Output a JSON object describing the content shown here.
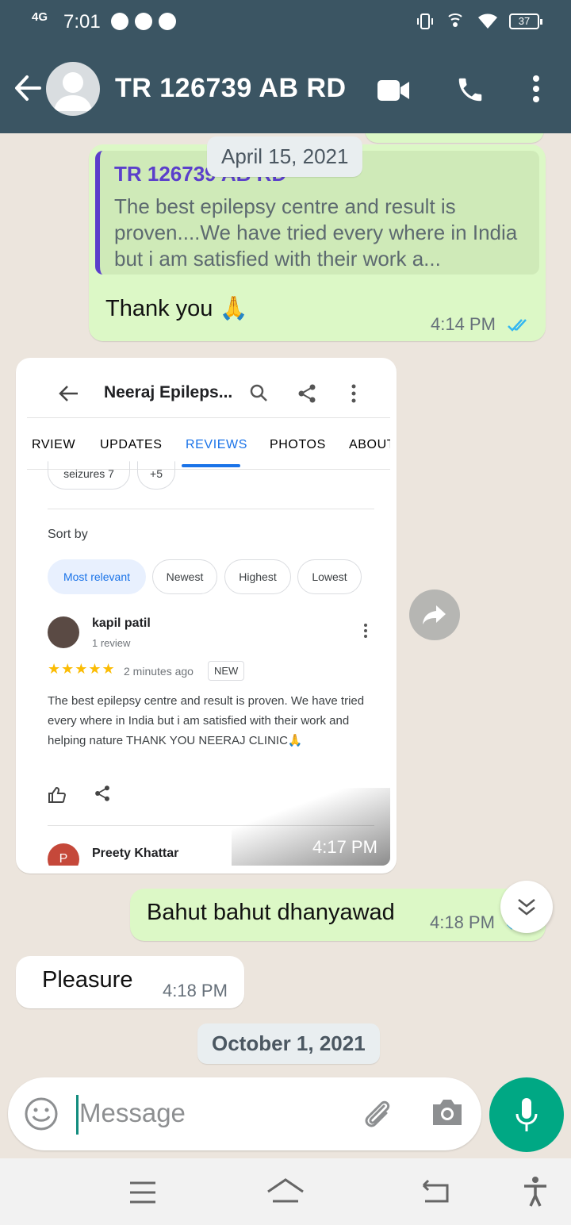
{
  "status_bar": {
    "network": "4G",
    "time": "7:01",
    "battery": "37"
  },
  "header": {
    "contact_name": "TR 126739 AB RD"
  },
  "chat": {
    "date_top": "April 15, 2021",
    "reply_message": {
      "quoted_author": "TR 126739 AB RD",
      "quoted_text": "The best epilepsy centre and result is proven....We have tried every where in India but i am satisfied with their work a...",
      "text": "Thank you 🙏",
      "time": "4:14 PM"
    },
    "image_message": {
      "time": "4:17 PM",
      "screenshot": {
        "title": "Neeraj Epileps...",
        "tabs": [
          "RVIEW",
          "UPDATES",
          "REVIEWS",
          "PHOTOS",
          "ABOUT"
        ],
        "topic_chips": [
          "seizures 7",
          "+5"
        ],
        "sort_label": "Sort by",
        "sort_chips": [
          "Most relevant",
          "Newest",
          "Highest",
          "Lowest"
        ],
        "reviewer": "kapil patil",
        "reviewer_meta": "1 review",
        "stars": "★★★★★",
        "review_time": "2 minutes ago",
        "new_badge": "NEW",
        "review_text": "The best epilepsy centre and result is proven. We have tried every where in India but i am satisfied with their work and helping nature  THANK YOU NEERAJ CLINIC🙏",
        "next_reviewer": "Preety Khattar",
        "next_initial": "P"
      }
    },
    "outgoing_2": {
      "text": "Bahut bahut dhanyawad",
      "time": "4:18 PM"
    },
    "incoming_1": {
      "text": "Pleasure",
      "time": "4:18 PM"
    },
    "date_bottom": "October 1, 2021"
  },
  "input": {
    "placeholder": "Message"
  },
  "colors": {
    "header": "#3b5563",
    "outgoing": "#dcf8c6",
    "accent": "#00a884",
    "ticks": "#34b7f1"
  }
}
